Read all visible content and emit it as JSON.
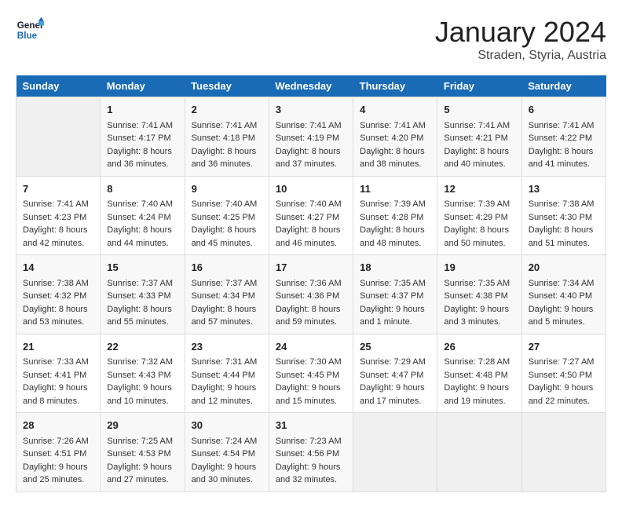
{
  "header": {
    "logo_line1": "General",
    "logo_line2": "Blue",
    "main_title": "January 2024",
    "subtitle": "Straden, Styria, Austria"
  },
  "calendar": {
    "days_of_week": [
      "Sunday",
      "Monday",
      "Tuesday",
      "Wednesday",
      "Thursday",
      "Friday",
      "Saturday"
    ],
    "weeks": [
      [
        {
          "day": "",
          "info": ""
        },
        {
          "day": "1",
          "info": "Sunrise: 7:41 AM\nSunset: 4:17 PM\nDaylight: 8 hours\nand 36 minutes."
        },
        {
          "day": "2",
          "info": "Sunrise: 7:41 AM\nSunset: 4:18 PM\nDaylight: 8 hours\nand 36 minutes."
        },
        {
          "day": "3",
          "info": "Sunrise: 7:41 AM\nSunset: 4:19 PM\nDaylight: 8 hours\nand 37 minutes."
        },
        {
          "day": "4",
          "info": "Sunrise: 7:41 AM\nSunset: 4:20 PM\nDaylight: 8 hours\nand 38 minutes."
        },
        {
          "day": "5",
          "info": "Sunrise: 7:41 AM\nSunset: 4:21 PM\nDaylight: 8 hours\nand 40 minutes."
        },
        {
          "day": "6",
          "info": "Sunrise: 7:41 AM\nSunset: 4:22 PM\nDaylight: 8 hours\nand 41 minutes."
        }
      ],
      [
        {
          "day": "7",
          "info": "Sunrise: 7:41 AM\nSunset: 4:23 PM\nDaylight: 8 hours\nand 42 minutes."
        },
        {
          "day": "8",
          "info": "Sunrise: 7:40 AM\nSunset: 4:24 PM\nDaylight: 8 hours\nand 44 minutes."
        },
        {
          "day": "9",
          "info": "Sunrise: 7:40 AM\nSunset: 4:25 PM\nDaylight: 8 hours\nand 45 minutes."
        },
        {
          "day": "10",
          "info": "Sunrise: 7:40 AM\nSunset: 4:27 PM\nDaylight: 8 hours\nand 46 minutes."
        },
        {
          "day": "11",
          "info": "Sunrise: 7:39 AM\nSunset: 4:28 PM\nDaylight: 8 hours\nand 48 minutes."
        },
        {
          "day": "12",
          "info": "Sunrise: 7:39 AM\nSunset: 4:29 PM\nDaylight: 8 hours\nand 50 minutes."
        },
        {
          "day": "13",
          "info": "Sunrise: 7:38 AM\nSunset: 4:30 PM\nDaylight: 8 hours\nand 51 minutes."
        }
      ],
      [
        {
          "day": "14",
          "info": "Sunrise: 7:38 AM\nSunset: 4:32 PM\nDaylight: 8 hours\nand 53 minutes."
        },
        {
          "day": "15",
          "info": "Sunrise: 7:37 AM\nSunset: 4:33 PM\nDaylight: 8 hours\nand 55 minutes."
        },
        {
          "day": "16",
          "info": "Sunrise: 7:37 AM\nSunset: 4:34 PM\nDaylight: 8 hours\nand 57 minutes."
        },
        {
          "day": "17",
          "info": "Sunrise: 7:36 AM\nSunset: 4:36 PM\nDaylight: 8 hours\nand 59 minutes."
        },
        {
          "day": "18",
          "info": "Sunrise: 7:35 AM\nSunset: 4:37 PM\nDaylight: 9 hours\nand 1 minute."
        },
        {
          "day": "19",
          "info": "Sunrise: 7:35 AM\nSunset: 4:38 PM\nDaylight: 9 hours\nand 3 minutes."
        },
        {
          "day": "20",
          "info": "Sunrise: 7:34 AM\nSunset: 4:40 PM\nDaylight: 9 hours\nand 5 minutes."
        }
      ],
      [
        {
          "day": "21",
          "info": "Sunrise: 7:33 AM\nSunset: 4:41 PM\nDaylight: 9 hours\nand 8 minutes."
        },
        {
          "day": "22",
          "info": "Sunrise: 7:32 AM\nSunset: 4:43 PM\nDaylight: 9 hours\nand 10 minutes."
        },
        {
          "day": "23",
          "info": "Sunrise: 7:31 AM\nSunset: 4:44 PM\nDaylight: 9 hours\nand 12 minutes."
        },
        {
          "day": "24",
          "info": "Sunrise: 7:30 AM\nSunset: 4:45 PM\nDaylight: 9 hours\nand 15 minutes."
        },
        {
          "day": "25",
          "info": "Sunrise: 7:29 AM\nSunset: 4:47 PM\nDaylight: 9 hours\nand 17 minutes."
        },
        {
          "day": "26",
          "info": "Sunrise: 7:28 AM\nSunset: 4:48 PM\nDaylight: 9 hours\nand 19 minutes."
        },
        {
          "day": "27",
          "info": "Sunrise: 7:27 AM\nSunset: 4:50 PM\nDaylight: 9 hours\nand 22 minutes."
        }
      ],
      [
        {
          "day": "28",
          "info": "Sunrise: 7:26 AM\nSunset: 4:51 PM\nDaylight: 9 hours\nand 25 minutes."
        },
        {
          "day": "29",
          "info": "Sunrise: 7:25 AM\nSunset: 4:53 PM\nDaylight: 9 hours\nand 27 minutes."
        },
        {
          "day": "30",
          "info": "Sunrise: 7:24 AM\nSunset: 4:54 PM\nDaylight: 9 hours\nand 30 minutes."
        },
        {
          "day": "31",
          "info": "Sunrise: 7:23 AM\nSunset: 4:56 PM\nDaylight: 9 hours\nand 32 minutes."
        },
        {
          "day": "",
          "info": ""
        },
        {
          "day": "",
          "info": ""
        },
        {
          "day": "",
          "info": ""
        }
      ]
    ]
  }
}
